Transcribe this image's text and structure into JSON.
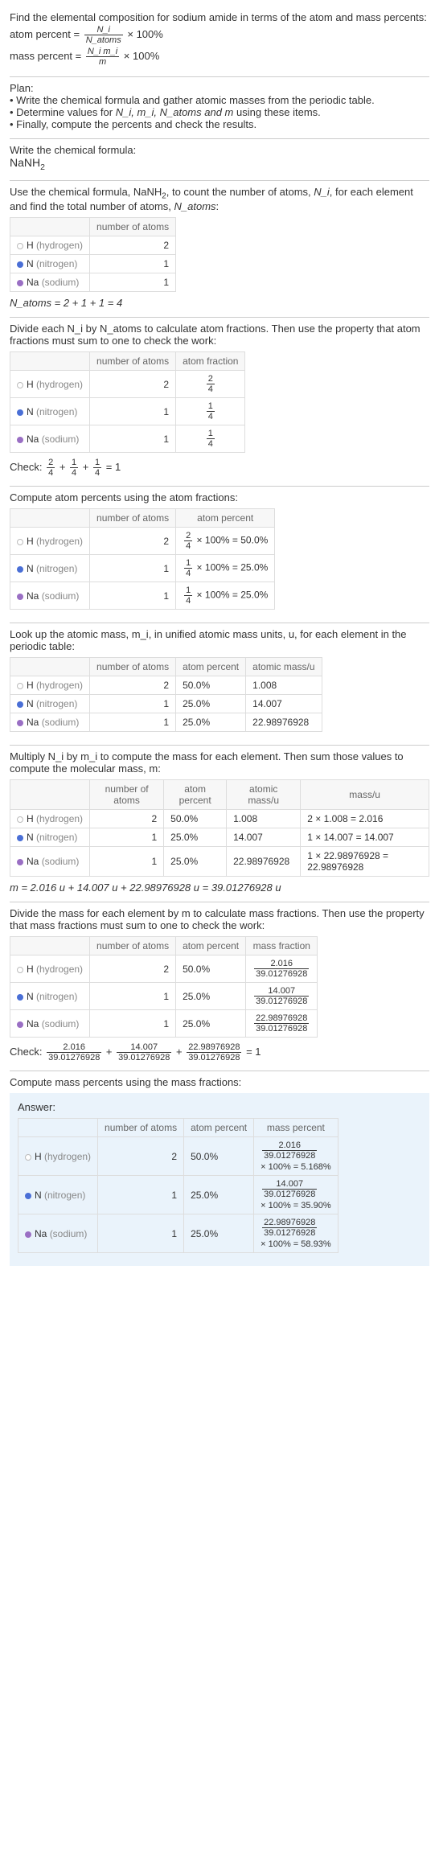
{
  "intro": {
    "line1": "Find the elemental composition for sodium amide in terms of the atom and mass percents:",
    "ap_label": "atom percent =",
    "ap_frac_num": "N_i",
    "ap_frac_den": "N_atoms",
    "times100": "× 100%",
    "mp_label": "mass percent =",
    "mp_frac_num": "N_i m_i",
    "mp_frac_den": "m"
  },
  "plan": {
    "title": "Plan:",
    "b1": "• Write the chemical formula and gather atomic masses from the periodic table.",
    "b2_a": "• Determine values for ",
    "b2_b": " using these items.",
    "vars": "N_i, m_i, N_atoms and m",
    "b3": "• Finally, compute the percents and check the results."
  },
  "formula": {
    "title": "Write the chemical formula:",
    "val": "NaNH",
    "sub": "2"
  },
  "count": {
    "text_a": "Use the chemical formula, NaNH",
    "text_b": ", to count the number of atoms, ",
    "text_c": ", for each element and find the total number of atoms, ",
    "ni": "N_i",
    "na": "N_atoms",
    "colon": ":",
    "hdr_num": "number of atoms",
    "h_label": "H",
    "h_gray": "(hydrogen)",
    "h_n": "2",
    "n_label": "N",
    "n_gray": "(nitrogen)",
    "n_n": "1",
    "na_label": "Na",
    "na_gray": "(sodium)",
    "na_n": "1",
    "sum": "N_atoms = 2 + 1 + 1 = 4"
  },
  "atomfrac": {
    "text": "Divide each N_i by N_atoms to calculate atom fractions. Then use the property that atom fractions must sum to one to check the work:",
    "hdr_num": "number of atoms",
    "hdr_af": "atom fraction",
    "h_n": "2",
    "h_f_num": "2",
    "h_f_den": "4",
    "n_n": "1",
    "n_f_num": "1",
    "n_f_den": "4",
    "na_n": "1",
    "na_f_num": "1",
    "na_f_den": "4",
    "check": "Check: ",
    "check_end": " = 1"
  },
  "atompct": {
    "text": "Compute atom percents using the atom fractions:",
    "hdr_num": "number of atoms",
    "hdr_ap": "atom percent",
    "h_n": "2",
    "h_p": " × 100% = 50.0%",
    "h_num": "2",
    "h_den": "4",
    "n_n": "1",
    "n_p": " × 100% = 25.0%",
    "n_num": "1",
    "n_den": "4",
    "na_n": "1",
    "na_p": " × 100% = 25.0%",
    "na_num": "1",
    "na_den": "4"
  },
  "amass": {
    "text": "Look up the atomic mass, m_i, in unified atomic mass units, u, for each element in the periodic table:",
    "hdr_num": "number of atoms",
    "hdr_ap": "atom percent",
    "hdr_am": "atomic mass/u",
    "h_n": "2",
    "h_p": "50.0%",
    "h_m": "1.008",
    "n_n": "1",
    "n_p": "25.0%",
    "n_m": "14.007",
    "na_n": "1",
    "na_p": "25.0%",
    "na_m": "22.98976928"
  },
  "mmass": {
    "text": "Multiply N_i by m_i to compute the mass for each element. Then sum those values to compute the molecular mass, m:",
    "hdr_num": "number of atoms",
    "hdr_ap": "atom percent",
    "hdr_am": "atomic mass/u",
    "hdr_mu": "mass/u",
    "h_n": "2",
    "h_p": "50.0%",
    "h_m": "1.008",
    "h_mu": "2 × 1.008 = 2.016",
    "n_n": "1",
    "n_p": "25.0%",
    "n_m": "14.007",
    "n_mu": "1 × 14.007 = 14.007",
    "na_n": "1",
    "na_p": "25.0%",
    "na_m": "22.98976928",
    "na_mu": "1 × 22.98976928 = 22.98976928",
    "sum": "m = 2.016 u + 14.007 u + 22.98976928 u = 39.01276928 u"
  },
  "massfrac": {
    "text": "Divide the mass for each element by m to calculate mass fractions. Then use the property that mass fractions must sum to one to check the work:",
    "hdr_num": "number of atoms",
    "hdr_ap": "atom percent",
    "hdr_mf": "mass fraction",
    "h_n": "2",
    "h_p": "50.0%",
    "h_num": "2.016",
    "h_den": "39.01276928",
    "n_n": "1",
    "n_p": "25.0%",
    "n_num": "14.007",
    "n_den": "39.01276928",
    "na_n": "1",
    "na_p": "25.0%",
    "na_num": "22.98976928",
    "na_den": "39.01276928",
    "check": "Check: ",
    "plus": " + ",
    "check_end": " = 1"
  },
  "final": {
    "text": "Compute mass percents using the mass fractions:",
    "answer": "Answer:",
    "hdr_num": "number of atoms",
    "hdr_ap": "atom percent",
    "hdr_mp": "mass percent",
    "h_n": "2",
    "h_p": "50.0%",
    "h_num": "2.016",
    "h_den": "39.01276928",
    "h_res": "× 100% = 5.168%",
    "n_n": "1",
    "n_p": "25.0%",
    "n_num": "14.007",
    "n_den": "39.01276928",
    "n_res": "× 100% = 35.90%",
    "na_n": "1",
    "na_p": "25.0%",
    "na_num": "22.98976928",
    "na_den": "39.01276928",
    "na_res": "× 100% = 58.93%"
  }
}
